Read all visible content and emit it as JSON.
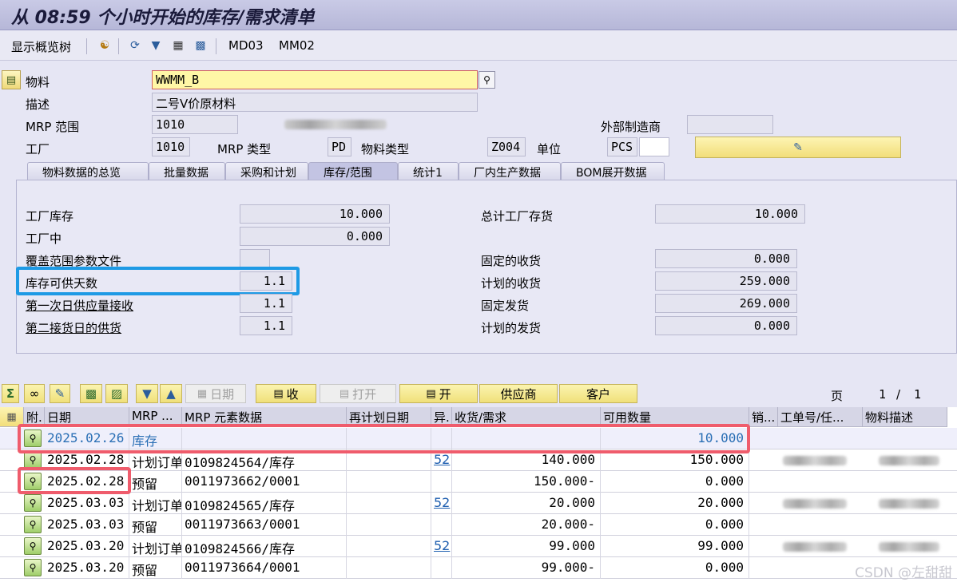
{
  "title": "从 08:59 个小时开始的库存/需求清单",
  "toolbar": {
    "show_tree": "显示概览树",
    "btn_md03": "MD03",
    "btn_mm02": "MM02"
  },
  "header": {
    "material_label": "物料",
    "material_value": "WWMM_B",
    "description_label": "描述",
    "description_value": "二号V价原材料",
    "mrp_area_label": "MRP 范围",
    "mrp_area_value": "1010",
    "external_mfr_label": "外部制造商",
    "plant_label": "工厂",
    "plant_value": "1010",
    "mrp_type_label": "MRP 类型",
    "mrp_type_value": "PD",
    "material_type_label": "物料类型",
    "material_type_value": "Z004",
    "unit_label": "单位",
    "unit_value": "PCS"
  },
  "tabs": [
    {
      "label": "物料数据的总览"
    },
    {
      "label": "批量数据"
    },
    {
      "label": "采购和计划"
    },
    {
      "label": "库存/范围"
    },
    {
      "label": "统计1"
    },
    {
      "label": "厂内生产数据"
    },
    {
      "label": "BOM展开数据"
    }
  ],
  "stock": {
    "plant_stock_label": "工厂库存",
    "plant_stock_value": "10.000",
    "in_plant_label": "工厂中",
    "in_plant_value": "0.000",
    "coverage_profile_label": "覆盖范围参数文件",
    "stock_days_label": "库存可供天数",
    "stock_days_value": "1.1",
    "first_receipt_label": "第一次日供应量接收",
    "first_receipt_value": "1.1",
    "second_receipt_label": "第二接货日的供货",
    "second_receipt_value": "1.1",
    "total_plant_stock_label": "总计工厂存货",
    "total_plant_stock_value": "10.000",
    "firm_receipts_label": "固定的收货",
    "firm_receipts_value": "0.000",
    "planned_receipts_label": "计划的收货",
    "planned_receipts_value": "259.000",
    "firm_issues_label": "固定发货",
    "firm_issues_value": "269.000",
    "planned_issues_label": "计划的发货",
    "planned_issues_value": "0.000"
  },
  "list_toolbar": {
    "date_btn": "日期",
    "receipt_btn": "收",
    "open_btn": "打开",
    "open2_btn": "开",
    "vendor_btn": "供应商",
    "customer_btn": "客户",
    "page_label": "页",
    "page_current": "1",
    "page_sep": "/",
    "page_total": "1"
  },
  "columns": {
    "attach": "附.",
    "date": "日期",
    "mrp_element": "MRP ...",
    "mrp_data": "MRP 元素数据",
    "reschedule": "再计划日期",
    "exception": "异.",
    "receipt_req": "收货/需求",
    "available": "可用数量",
    "sales": "销...",
    "order_no": "工单号/任...",
    "material_desc": "物料描述"
  },
  "rows": [
    {
      "date": "2025.02.26",
      "element": "库存",
      "data": "",
      "exception": "",
      "qty": "",
      "available": "10.000"
    },
    {
      "date": "2025.02.28",
      "element": "计划订单",
      "data": "0109824564/库存",
      "exception": "52",
      "qty": "140.000",
      "available": "150.000"
    },
    {
      "date": "2025.02.28",
      "element": "预留",
      "data": "0011973662/0001",
      "exception": "",
      "qty": "150.000-",
      "available": "0.000"
    },
    {
      "date": "2025.03.03",
      "element": "计划订单",
      "data": "0109824565/库存",
      "exception": "52",
      "qty": "20.000",
      "available": "20.000"
    },
    {
      "date": "2025.03.03",
      "element": "预留",
      "data": "0011973663/0001",
      "exception": "",
      "qty": "20.000-",
      "available": "0.000"
    },
    {
      "date": "2025.03.20",
      "element": "计划订单",
      "data": "0109824566/库存",
      "exception": "52",
      "qty": "99.000",
      "available": "99.000"
    },
    {
      "date": "2025.03.20",
      "element": "预留",
      "data": "0011973664/0001",
      "exception": "",
      "qty": "99.000-",
      "available": "0.000"
    }
  ],
  "watermark": "CSDN @左甜甜"
}
